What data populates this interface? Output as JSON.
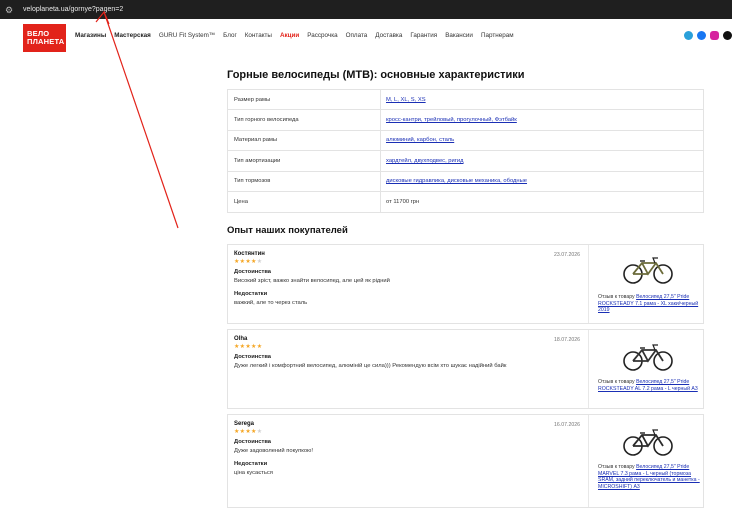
{
  "browser": {
    "url": "veloplaneta.ua/gornye?pagen=2"
  },
  "header": {
    "logo_line1": "ВЕЛО",
    "logo_line2": "ПЛАНЕТА",
    "nav": [
      "Магазины",
      "Мастерская",
      "GURU Fit System™",
      "Блог",
      "Контакты",
      "Акции",
      "Рассрочка",
      "Оплата",
      "Доставка",
      "Гарантия",
      "Вакансии",
      "Партнерам"
    ],
    "social_icons": [
      "telegram-icon",
      "facebook-icon",
      "instagram-icon",
      "tiktok-icon"
    ]
  },
  "specs": {
    "title": "Горные велосипеды (MTB): основные характеристики",
    "rows": [
      {
        "key": "Размер рамы",
        "value": "M, L, XL, S, XS"
      },
      {
        "key": "Тип горного велосипеда",
        "value": "кросс-кантри, трейловый, прогулочный, Фэтбайк"
      },
      {
        "key": "Материал рамы",
        "value": "алюминий, карбон, сталь"
      },
      {
        "key": "Тип амортизации",
        "value": "хардтейл, двухподвес, ригид"
      },
      {
        "key": "Тип тормозов",
        "value": "дисковые гидравлика, дисковые механика, ободные"
      },
      {
        "key": "Цена",
        "value": "от 11700 грн"
      }
    ]
  },
  "reviews_title": "Опыт наших покупателей",
  "reviews": [
    {
      "author": "Костянтин",
      "date": "23.07.2026",
      "stars": "★★★★",
      "stars_off": "★",
      "pros_label": "Достоинства",
      "pros": "Високий зріст, важко знайти велосипед, але цей як рідний",
      "cons_label": "Недостатки",
      "cons": "важкий, але то через сталь",
      "product_prefix": "Отзыв к товару ",
      "product_link": "Велосипед 27,5\" Pride ROCKSTEADY 7.1 рама - XL хаки/черный 2019"
    },
    {
      "author": "Olha",
      "date": "18.07.2026",
      "stars": "★★★★★",
      "stars_off": "",
      "pros_label": "Достоинства",
      "pros": "Дуже легкий і комфортний велосипед, алюміній це сила))) Рекомендую всім хто шукає надійний байк",
      "cons_label": "",
      "cons": "",
      "product_prefix": "Отзыв к товару ",
      "product_link": "Велосипед 27,5\" Pride ROCKSTEADY AL 7.2 рама - L черный A3"
    },
    {
      "author": "Serega",
      "date": "16.07.2026",
      "stars": "★★★★",
      "stars_off": "★",
      "pros_label": "Достоинства",
      "pros": "Дуже задоволений покупкою!",
      "cons_label": "Недостатки",
      "cons": "ціна кусається",
      "product_prefix": "Отзыв к товару ",
      "product_link": "Велосипед 27,5\" Pride MARVEL 7.3 рама - L черный (тормоза SRAM, задний переключатель и манетка - MICROSHIFT) A3"
    }
  ]
}
